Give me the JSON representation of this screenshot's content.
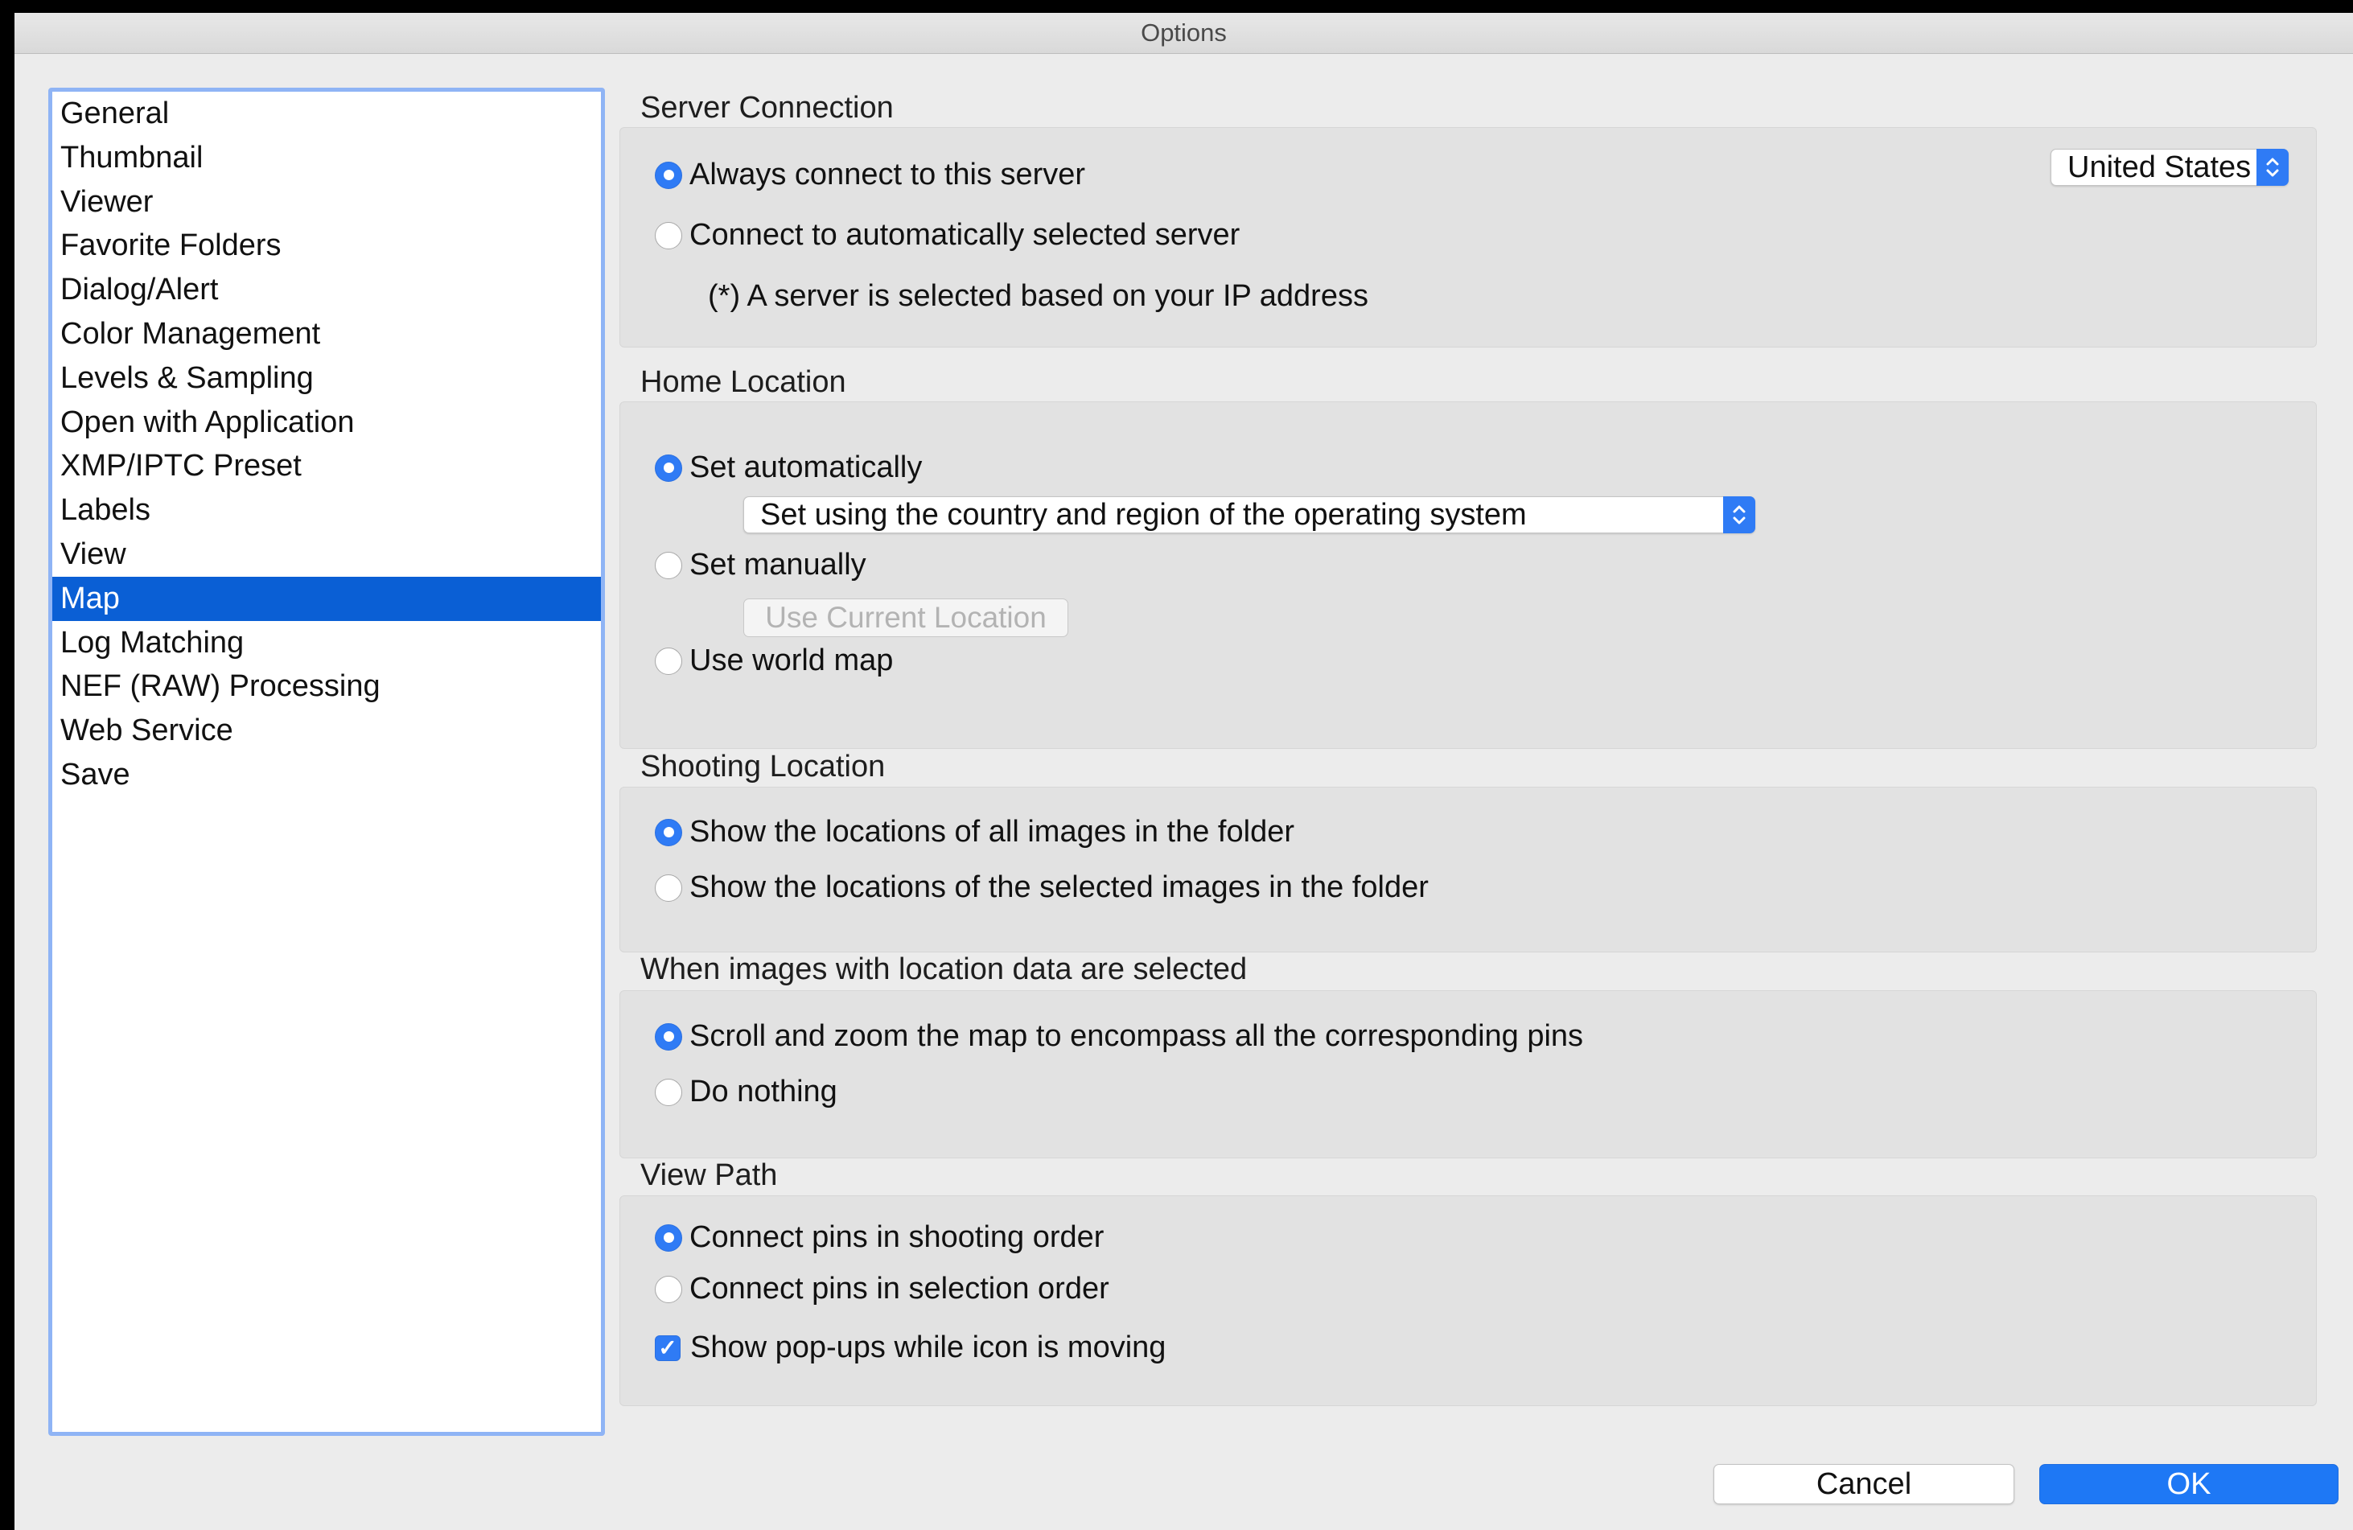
{
  "window": {
    "title": "Options"
  },
  "sidebar": {
    "items": [
      {
        "label": "General",
        "selected": false
      },
      {
        "label": "Thumbnail",
        "selected": false
      },
      {
        "label": "Viewer",
        "selected": false
      },
      {
        "label": "Favorite Folders",
        "selected": false
      },
      {
        "label": "Dialog/Alert",
        "selected": false
      },
      {
        "label": "Color Management",
        "selected": false
      },
      {
        "label": "Levels & Sampling",
        "selected": false
      },
      {
        "label": "Open with Application",
        "selected": false
      },
      {
        "label": "XMP/IPTC Preset",
        "selected": false
      },
      {
        "label": "Labels",
        "selected": false
      },
      {
        "label": "View",
        "selected": false
      },
      {
        "label": "Map",
        "selected": true
      },
      {
        "label": "Log Matching",
        "selected": false
      },
      {
        "label": "NEF (RAW) Processing",
        "selected": false
      },
      {
        "label": "Web Service",
        "selected": false
      },
      {
        "label": "Save",
        "selected": false
      }
    ]
  },
  "server_connection": {
    "title": "Server Connection",
    "always_connect": {
      "label": "Always connect to this server",
      "checked": true
    },
    "auto_select": {
      "label": "Connect to automatically selected server",
      "checked": false
    },
    "note": "(*) A server is selected based on your IP address",
    "server_select": {
      "value": "United States"
    }
  },
  "home_location": {
    "title": "Home Location",
    "set_automatically": {
      "label": "Set automatically",
      "checked": true
    },
    "auto_select": {
      "value": "Set using the country and region of the operating system"
    },
    "set_manually": {
      "label": "Set manually",
      "checked": false
    },
    "use_current_location": {
      "label": "Use Current Location",
      "enabled": false
    },
    "use_world_map": {
      "label": "Use world map",
      "checked": false
    }
  },
  "shooting_location": {
    "title": "Shooting Location",
    "all_images": {
      "label": "Show the locations of all images in the folder",
      "checked": true
    },
    "selected_images": {
      "label": "Show the locations of the selected images in the folder",
      "checked": false
    }
  },
  "location_selected": {
    "title": "When images with location data are selected",
    "scroll_zoom": {
      "label": "Scroll and zoom the map to encompass all the corresponding pins",
      "checked": true
    },
    "do_nothing": {
      "label": "Do nothing",
      "checked": false
    }
  },
  "view_path": {
    "title": "View Path",
    "shooting_order": {
      "label": "Connect pins in shooting order",
      "checked": true
    },
    "selection_order": {
      "label": "Connect pins in selection order",
      "checked": false
    },
    "show_popups": {
      "label": "Show pop-ups while icon is moving",
      "checked": true
    }
  },
  "footer": {
    "cancel_label": "Cancel",
    "ok_label": "OK"
  },
  "colors": {
    "accent": "#2f7bf5",
    "selection": "#0a5fd5",
    "focus_ring": "#8fb4f5"
  }
}
